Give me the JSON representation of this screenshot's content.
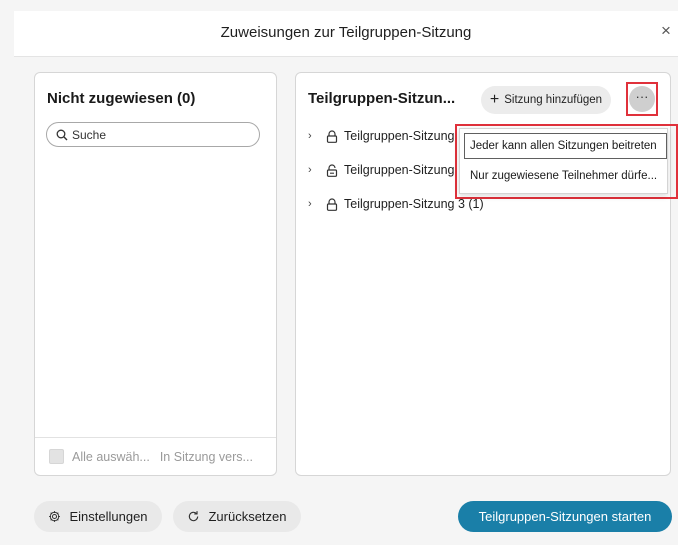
{
  "dialog": {
    "title": "Zuweisungen zur Teilgruppen-Sitzung",
    "close_label": "×"
  },
  "left_panel": {
    "title": "Nicht zugewiesen (0)",
    "search_placeholder": "Suche",
    "select_all_label": "Alle auswäh...",
    "move_to_label": "In Sitzung vers..."
  },
  "right_panel": {
    "title": "Teilgruppen-Sitzun...",
    "add_session_label": "Sitzung hinzufügen",
    "more_label": "···",
    "sessions": [
      {
        "label": "Teilgruppen-Sitzung",
        "icon": "lock-icon"
      },
      {
        "label": "Teilgruppen-Sitzung",
        "icon": "lock-open-icon"
      },
      {
        "label": "Teilgruppen-Sitzung 3 (1)",
        "icon": "lock-icon"
      }
    ]
  },
  "menu": {
    "items": [
      {
        "label": "Jeder kann allen Sitzungen beitreten"
      },
      {
        "label": "Nur zugewiesene Teilnehmer dürfe..."
      }
    ]
  },
  "footer": {
    "settings_label": "Einstellungen",
    "reset_label": "Zurücksetzen",
    "start_label": "Teilgruppen-Sitzungen starten"
  },
  "colors": {
    "accent": "#1a7fa8",
    "highlight": "#e0313b"
  }
}
